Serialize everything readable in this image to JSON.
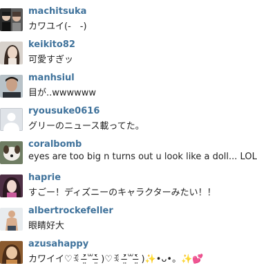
{
  "theme": {
    "username_color": "#3f729b",
    "text_color": "#222222"
  },
  "comments": [
    {
      "username": "machitsuka",
      "text": "カワユイ(-　-)",
      "avatar": "avatar-photo-two-people"
    },
    {
      "username": "keikito82",
      "text": "可愛すぎッ",
      "avatar": "avatar-photo-woman"
    },
    {
      "username": "manhsiul",
      "text": "目が..wwwwww",
      "avatar": "avatar-photo-man"
    },
    {
      "username": "ryousuke0616",
      "text": "グリーのニュース載ってた。",
      "avatar": "avatar-default-silhouette"
    },
    {
      "username": "coralbomb",
      "text": "eyes are too big n turns out u look like a doll... LOL",
      "avatar": "avatar-photo-dog"
    },
    {
      "username": "haprie",
      "text": "すごー！ディズニーのキャラクターみたい！！",
      "avatar": "avatar-photo-girl"
    },
    {
      "username": "albertrockefeller",
      "text": "眼睛好大",
      "avatar": "avatar-photo-shirtless-man"
    },
    {
      "username": "azusahappy",
      "text": "カワイイ♡ꉂ ˃̶̤́꒳˂̶̤̀ )♡ꉂ ˃̶̤́꒳˂̶̤̀ )✨•ᴗ•。✨💕",
      "avatar": "avatar-photo-warm-portrait"
    }
  ]
}
